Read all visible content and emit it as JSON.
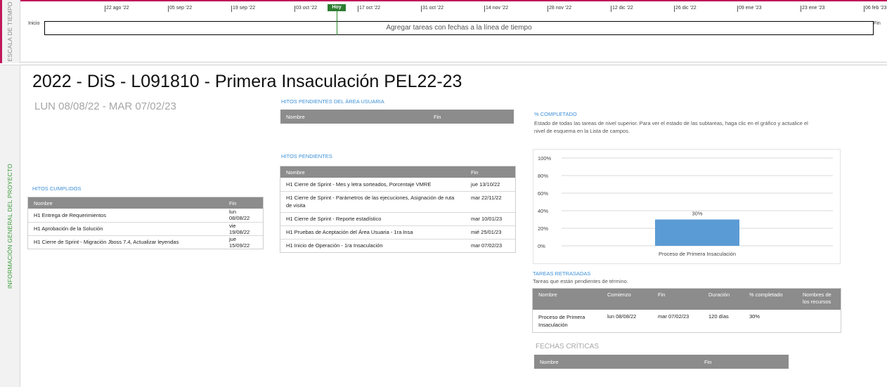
{
  "side_labels": {
    "timeline": "ESCALA DE TIEMPO",
    "overview": "INFORMACIÓN GENERAL DEL PROYECTO"
  },
  "timeline": {
    "start_label": "Inicio",
    "end_label": "Fin",
    "today_label": "Hoy",
    "placeholder": "Agregar tareas con fechas a la línea de tiempo",
    "ticks": [
      "22 ago '22",
      "05 sep '22",
      "19 sep '22",
      "03 oct '22",
      "17 oct '22",
      "31 oct '22",
      "14 nov '22",
      "28 nov '22",
      "12 dic '22",
      "26 dic '22",
      "09 ene '23",
      "23 ene '23",
      "06 feb '23"
    ]
  },
  "project": {
    "title": "2022 - DiS - L091810 - Primera Insaculación PEL22-23",
    "dates": "LUN 08/08/22 - MAR 07/02/23"
  },
  "hitos_cumplidos": {
    "title": "HITOS CUMPLIDOS",
    "columns": [
      "Nombre",
      "Fin"
    ],
    "rows": [
      [
        "H1 Entrega de Requerimientos",
        "lun 08/08/22"
      ],
      [
        "H1 Aprobación de la Solución",
        "vie 19/08/22"
      ],
      [
        "H1 Cierre de Sprint - Migración Jboss 7.4, Actualizar leyendas",
        "jue 15/09/22"
      ]
    ]
  },
  "hitos_area_usuaria": {
    "title": "HITOS PENDIENTES DEL ÁREA USUARIA",
    "columns": [
      "Nombre",
      "Fin"
    ]
  },
  "hitos_pendientes": {
    "title": "HITOS PENDIENTES",
    "columns": [
      "Nombre",
      "Fin"
    ],
    "rows": [
      [
        "H1 Cierre de Sprint - Mes y letra sorteados, Porcentaje VMRE",
        "jue 13/10/22"
      ],
      [
        "H1 Cierre de Sprint - Parámetros de las ejecuciones, Asignación de ruta de visita",
        "mar 22/11/22"
      ],
      [
        "H1 Cierre de Sprint - Reporte estadístico",
        "mar 10/01/23"
      ],
      [
        "H1 Pruebas de Aceptación del Área Usuaria - 1ra Insa",
        "mié 25/01/23"
      ],
      [
        "H1 Inicio de Operación - 1ra Insaculación",
        "mar 07/02/23"
      ]
    ]
  },
  "completado": {
    "title": "% COMPLETADO",
    "description": "Estado de todas las tareas de nivel superior. Para ver el estado de las subtareas, haga clic en el gráfico y actualice el nivel de esquema en la Lista de campos."
  },
  "chart_data": {
    "type": "bar",
    "categories": [
      "Proceso de Primera Insaculación"
    ],
    "values": [
      30
    ],
    "data_labels": [
      "30%"
    ],
    "y_ticks": [
      "0%",
      "20%",
      "40%",
      "60%",
      "80%",
      "100%"
    ],
    "ylim": [
      0,
      100
    ],
    "bar_color": "#5b9bd5",
    "grid": true
  },
  "tareas_retrasadas": {
    "title": "TAREAS RETRASADAS",
    "description": "Tareas que están pendientes de término.",
    "columns": [
      "Nombre",
      "Comienzo",
      "Fin",
      "Duración",
      "% completado",
      "Nombres de los recursos"
    ],
    "rows": [
      [
        "Proceso de Primera Insaculación",
        "lun 08/08/22",
        "mar 07/02/23",
        "120 días",
        "30%",
        ""
      ]
    ]
  },
  "fechas_criticas": {
    "title": "FECHAS CRÍTICAS",
    "columns": [
      "Nombre",
      "Fin"
    ]
  },
  "colors": {
    "accent_timeline": "#c0175a",
    "today_green": "#2e7d32",
    "section_blue": "#3b8fd6",
    "header_gray": "#8c8c8c"
  }
}
